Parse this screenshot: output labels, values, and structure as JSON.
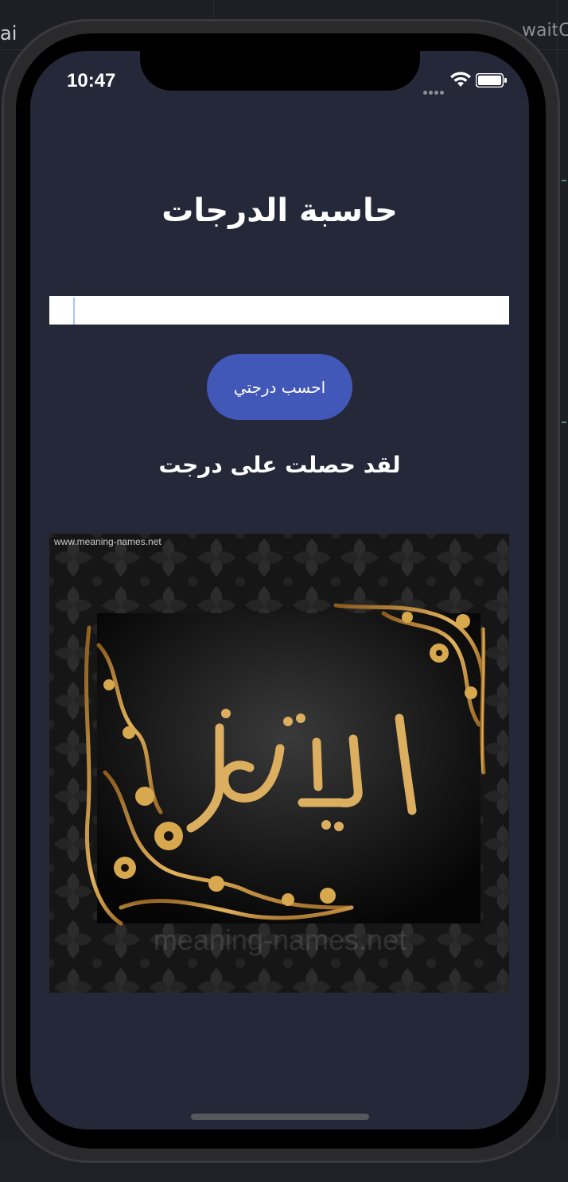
{
  "window": {
    "bg_title_fragment": "ai",
    "bg_right_fragment": "waitC"
  },
  "status_bar": {
    "time": "10:47"
  },
  "app": {
    "title": "حاسبة الدرجات",
    "grade_input": {
      "value": "",
      "placeholder": ""
    },
    "calculate_button_label": "احسب درجتي",
    "result_text": "لقد حصلت على درجت",
    "result_image": {
      "watermark_top": "www.meaning-names.net",
      "watermark_bottom": "meaning-names.net",
      "calligraphy_word": "امتياز"
    }
  },
  "colors": {
    "screen_bg": "#242838",
    "button_bg": "#4258b8",
    "text": "#ffffff",
    "gold": "#d8a84e"
  }
}
